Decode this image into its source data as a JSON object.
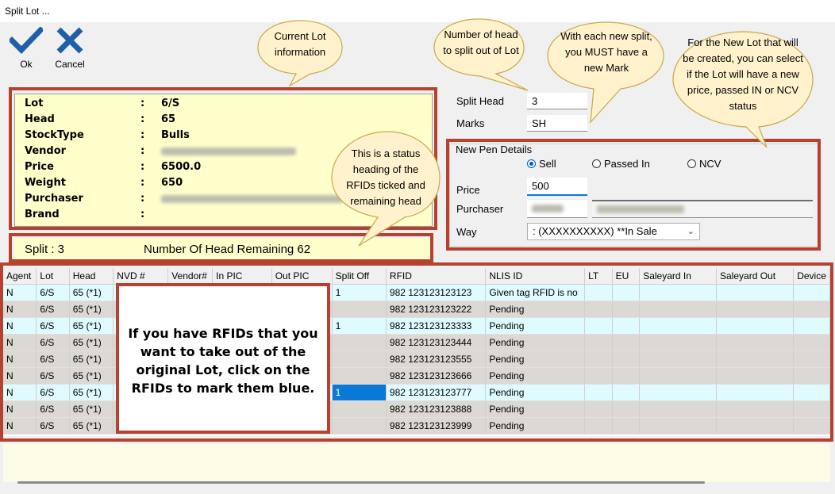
{
  "window": {
    "title": "Split Lot ..."
  },
  "toolbar": {
    "ok_label": "Ok",
    "cancel_label": "Cancel"
  },
  "lot": {
    "labels": {
      "lot": "Lot",
      "head": "Head",
      "stocktype": "StockType",
      "vendor": "Vendor",
      "price": "Price",
      "weight": "Weight",
      "purchaser": "Purchaser",
      "brand": "Brand"
    },
    "colon": ":",
    "values": {
      "lot": "6/S",
      "head": "65",
      "stocktype": "Bulls",
      "price": "6500.0",
      "weight": "650"
    }
  },
  "status": {
    "split": "Split : 3",
    "remaining": "Number Of Head Remaining 62"
  },
  "form": {
    "split_head_label": "Split Head",
    "split_head_value": "3",
    "marks_label": "Marks",
    "marks_value": "SH",
    "group_title": "New Pen Details",
    "radio": {
      "sell": "Sell",
      "passed_in": "Passed In",
      "ncv": "NCV",
      "selected": "sell"
    },
    "price_label": "Price",
    "price_value": "500",
    "purchaser_label": "Purchaser",
    "way_label": "Way",
    "way_value": ": (XXXXXXXXXX) **In Sale"
  },
  "table": {
    "columns": [
      "Agent",
      "Lot",
      "Head",
      "NVD #",
      "Vendor#",
      "In PIC",
      "Out PIC",
      "Split Off",
      "RFID",
      "NLIS ID",
      "LT",
      "EU",
      "Saleyard In",
      "Saleyard Out",
      "Device"
    ],
    "rows": [
      [
        "N",
        "6/S",
        "65 (*1)",
        "",
        "",
        "",
        "",
        "1",
        "982 123123123123",
        "Given tag RFID is no",
        "",
        "",
        "",
        "",
        ""
      ],
      [
        "N",
        "6/S",
        "65 (*1)",
        "",
        "",
        "",
        "",
        "",
        "982 123123123222",
        "Pending",
        "",
        "",
        "",
        "",
        ""
      ],
      [
        "N",
        "6/S",
        "65 (*1)",
        "",
        "",
        "",
        "",
        "1",
        "982 123123123333",
        "Pending",
        "",
        "",
        "",
        "",
        ""
      ],
      [
        "N",
        "6/S",
        "65 (*1)",
        "",
        "",
        "",
        "",
        "",
        "982 123123123444",
        "Pending",
        "",
        "",
        "",
        "",
        ""
      ],
      [
        "N",
        "6/S",
        "65 (*1)",
        "",
        "",
        "",
        "",
        "",
        "982 123123123555",
        "Pending",
        "",
        "",
        "",
        "",
        ""
      ],
      [
        "N",
        "6/S",
        "65 (*1)",
        "",
        "",
        "",
        "",
        "",
        "982 123123123666",
        "Pending",
        "",
        "",
        "",
        "",
        ""
      ],
      [
        "N",
        "6/S",
        "65 (*1)",
        "",
        "",
        "",
        "",
        "1",
        "982 123123123777",
        "Pending",
        "",
        "",
        "",
        "",
        ""
      ],
      [
        "N",
        "6/S",
        "65 (*1)",
        "",
        "",
        "",
        "",
        "",
        "982 123123123888",
        "Pending",
        "",
        "",
        "",
        "",
        ""
      ],
      [
        "N",
        "6/S",
        "65 (*1)",
        "",
        "",
        "",
        "",
        "",
        "982 123123123999",
        "Pending",
        "",
        "",
        "",
        "",
        ""
      ]
    ],
    "row_styles": [
      "cyan",
      "gray",
      "cyan",
      "gray",
      "gray",
      "gray",
      "cyan",
      "gray",
      "gray"
    ]
  },
  "callouts": {
    "current_lot": "Current Lot information",
    "num_head": "Number of head to split out of Lot",
    "new_mark": "With each new split, you MUST have a new Mark",
    "new_lot": "For the New Lot that will be created, you can select if the Lot will have a new price, passed IN or NCV status",
    "status_heading": "This is a status heading of the RFIDs ticked and remaining head",
    "rfid_note": "If you have RFIDs that you want to take out of the original Lot, click on the RFIDs to mark them blue."
  },
  "colors": {
    "accent": "#0a78d7",
    "frame": "#b5422e",
    "callout_fill": "#fff2cc",
    "callout_stroke": "#c9a84b",
    "panel": "#ffffcc"
  },
  "icons": {
    "ok": "checkmark-icon",
    "cancel": "x-icon",
    "dropdown": "chevron-down-icon"
  }
}
